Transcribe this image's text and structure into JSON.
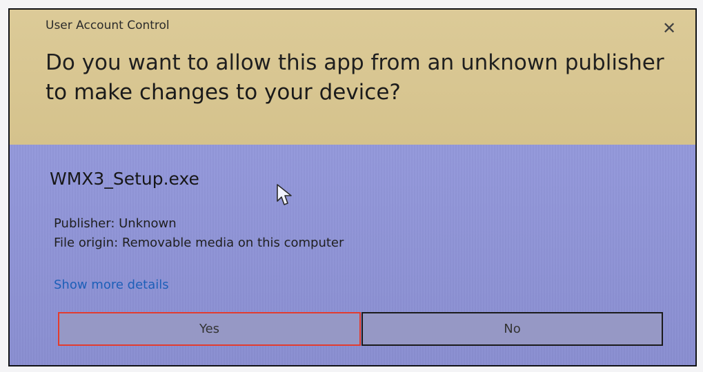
{
  "dialog": {
    "title": "User Account Control",
    "close_symbol": "✕",
    "question": "Do you want to allow this app from an unknown publisher to make changes to your device?",
    "app_name": "WMX3_Setup.exe",
    "publisher": "Publisher: Unknown",
    "file_origin": "File origin: Removable media on this computer",
    "details_link": "Show more details",
    "buttons": {
      "yes": "Yes",
      "no": "No"
    }
  },
  "colors": {
    "header_bg": "#d9c68f",
    "body_bg": "#8f94d9",
    "link": "#1d5fb8",
    "yes_border": "#e33b2e"
  }
}
